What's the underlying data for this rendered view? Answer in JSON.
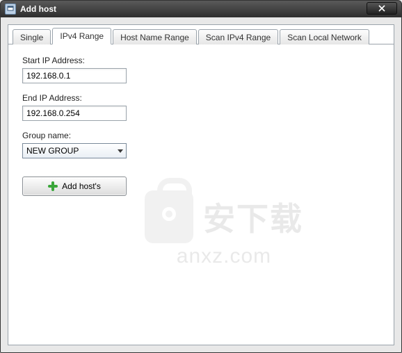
{
  "window": {
    "title": "Add host"
  },
  "tabs": [
    {
      "label": "Single"
    },
    {
      "label": "IPv4 Range"
    },
    {
      "label": "Host Name Range"
    },
    {
      "label": "Scan IPv4 Range"
    },
    {
      "label": "Scan Local Network"
    }
  ],
  "form": {
    "start_ip_label": "Start IP Address:",
    "start_ip_value": "192.168.0.1",
    "end_ip_label": "End IP Address:",
    "end_ip_value": "192.168.0.254",
    "group_label": "Group name:",
    "group_value": "NEW GROUP",
    "add_button_label": "Add host's"
  },
  "watermark": {
    "cn": "安下载",
    "en": "anxz.com"
  }
}
